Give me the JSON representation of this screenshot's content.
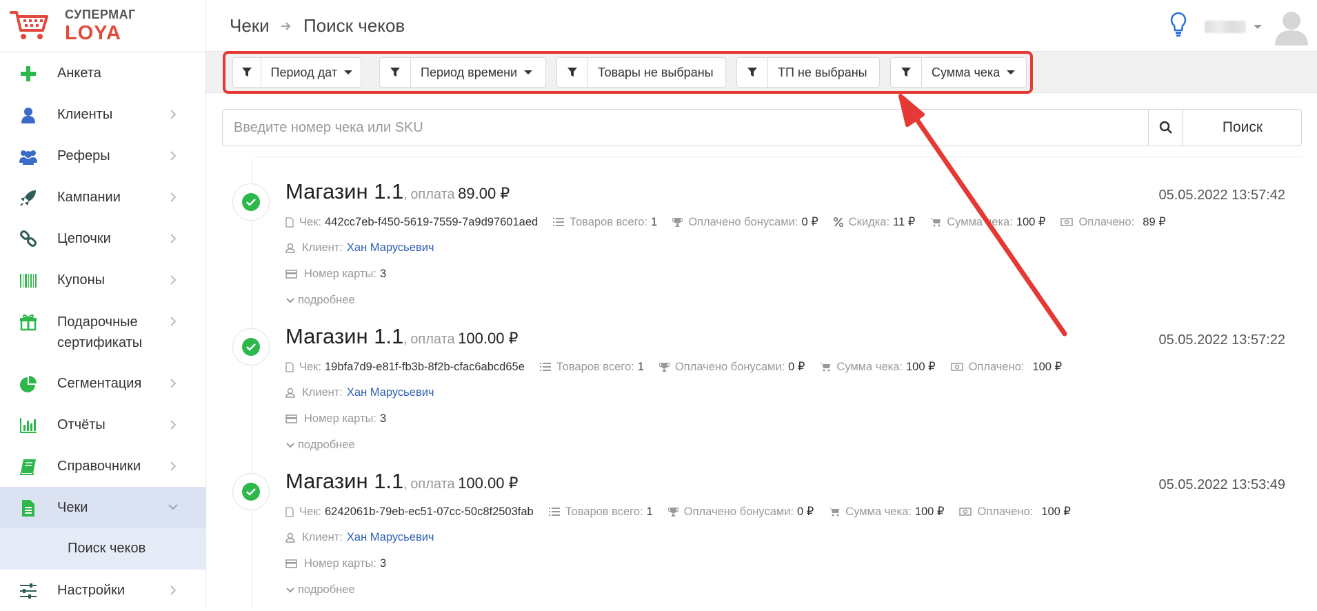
{
  "logo": {
    "top": "СУПЕРМАГ",
    "bottom": "LOYA",
    "brand_color": "#e24a3e"
  },
  "sidebar": {
    "items": [
      {
        "label": "Анкета",
        "icon": "plus-icon"
      },
      {
        "label": "Клиенты",
        "icon": "user-icon"
      },
      {
        "label": "Реферы",
        "icon": "users-icon"
      },
      {
        "label": "Кампании",
        "icon": "rocket-icon"
      },
      {
        "label": "Цепочки",
        "icon": "chain-icon"
      },
      {
        "label": "Купоны",
        "icon": "barcode-icon"
      },
      {
        "label": "Подарочные сертификаты",
        "line1": "Подарочные",
        "line2": "сертификаты",
        "icon": "gift-icon"
      },
      {
        "label": "Сегментация",
        "icon": "pie-chart-icon"
      },
      {
        "label": "Отчёты",
        "icon": "bar-chart-icon"
      },
      {
        "label": "Справочники",
        "icon": "book-icon"
      },
      {
        "label": "Чеки",
        "icon": "document-icon",
        "active": true
      },
      {
        "label": "Настройки",
        "icon": "sliders-icon"
      }
    ],
    "sub_item": "Поиск чеков"
  },
  "header": {
    "breadcrumb_1": "Чеки",
    "breadcrumb_2": "Поиск чеков"
  },
  "filters": [
    {
      "label": "Период дат",
      "has_caret": true
    },
    {
      "label": "Период времени",
      "has_caret": true
    },
    {
      "label": "Товары не выбраны",
      "has_caret": false
    },
    {
      "label": "ТП не выбраны",
      "has_caret": false
    },
    {
      "label": "Сумма чека",
      "has_caret": true
    }
  ],
  "search": {
    "placeholder": "Введите номер чека или SKU",
    "button": "Поиск"
  },
  "labels": {
    "comma": ",",
    "payment": "оплата",
    "currency": "₽",
    "receipt": "Чек:",
    "items_total": "Товаров всего:",
    "paid_bonuses": "Оплачено бонусами:",
    "discount": "Скидка:",
    "receipt_sum": "Сумма чека:",
    "paid": "Оплачено:",
    "client": "Клиент:",
    "card_number": "Номер карты:",
    "more": "подробнее"
  },
  "receipts": [
    {
      "store": "Магазин 1.1",
      "amount": "89.00 ₽",
      "datetime": "05.05.2022 13:57:42",
      "id": "442cc7eb-f450-5619-7559-7a9d97601aed",
      "items_total": "1",
      "paid_bonuses": "0 ₽",
      "discount": "11 ₽",
      "receipt_sum": "100 ₽",
      "paid": "89 ₽",
      "client": "Хан Марусьевич",
      "card_number": "3"
    },
    {
      "store": "Магазин 1.1",
      "amount": "100.00 ₽",
      "datetime": "05.05.2022 13:57:22",
      "id": "19bfa7d9-e81f-fb3b-8f2b-cfac6abcd65e",
      "items_total": "1",
      "paid_bonuses": "0 ₽",
      "receipt_sum": "100 ₽",
      "paid": "100 ₽",
      "client": "Хан Марусьевич",
      "card_number": "3"
    },
    {
      "store": "Магазин 1.1",
      "amount": "100.00 ₽",
      "datetime": "05.05.2022 13:53:49",
      "id": "6242061b-79eb-ec51-07cc-50c8f2503fab",
      "items_total": "1",
      "paid_bonuses": "0 ₽",
      "receipt_sum": "100 ₽",
      "paid": "100 ₽",
      "client": "Хан Марусьевич",
      "card_number": "3"
    }
  ],
  "colors": {
    "accent_green": "#2db84b",
    "link": "#2d5fb4",
    "highlight_red": "#e53935",
    "active_bg": "#dbe3f2"
  }
}
